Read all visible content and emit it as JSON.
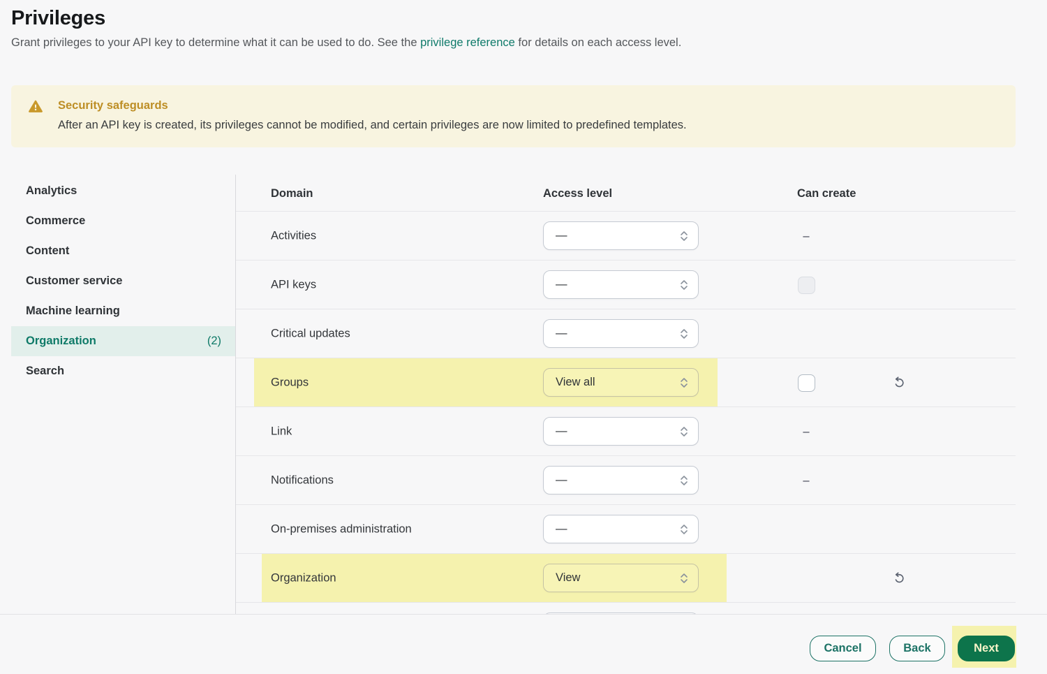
{
  "page": {
    "title": "Privileges",
    "subtitle_before": "Grant privileges to your API key to determine what it can be used to do. See the ",
    "subtitle_link": "privilege reference",
    "subtitle_after": " for details on each access level."
  },
  "warning": {
    "icon": "warning-triangle-icon",
    "title": "Security safeguards",
    "body": "After an API key is created, its privileges cannot be modified, and certain privileges are now limited to predefined templates."
  },
  "sidebar": {
    "items": [
      {
        "label": "Analytics",
        "selected": false,
        "badge": ""
      },
      {
        "label": "Commerce",
        "selected": false,
        "badge": ""
      },
      {
        "label": "Content",
        "selected": false,
        "badge": ""
      },
      {
        "label": "Customer service",
        "selected": false,
        "badge": ""
      },
      {
        "label": "Machine learning",
        "selected": false,
        "badge": ""
      },
      {
        "label": "Organization",
        "selected": true,
        "badge": "(2)"
      },
      {
        "label": "Search",
        "selected": false,
        "badge": ""
      }
    ]
  },
  "table": {
    "columns": {
      "domain": "Domain",
      "access": "Access level",
      "create": "Can create"
    },
    "dash": "–",
    "rows": [
      {
        "domain": "Activities",
        "access_level": "—",
        "can_create": "dash",
        "highlighted": false,
        "undo": false
      },
      {
        "domain": "API keys",
        "access_level": "—",
        "can_create": "checkbox-disabled",
        "highlighted": false,
        "undo": false
      },
      {
        "domain": "Critical updates",
        "access_level": "—",
        "can_create": "none",
        "highlighted": false,
        "undo": false
      },
      {
        "domain": "Groups",
        "access_level": "View all",
        "can_create": "checkbox-unchecked",
        "highlighted": true,
        "undo": true
      },
      {
        "domain": "Link",
        "access_level": "—",
        "can_create": "dash",
        "highlighted": false,
        "undo": false
      },
      {
        "domain": "Notifications",
        "access_level": "—",
        "can_create": "dash",
        "highlighted": false,
        "undo": false
      },
      {
        "domain": "On-premises administration",
        "access_level": "—",
        "can_create": "none",
        "highlighted": false,
        "undo": false
      },
      {
        "domain": "Organization",
        "access_level": "View",
        "can_create": "none",
        "highlighted": true,
        "undo": true
      },
      {
        "domain": "",
        "access_level": "",
        "can_create": "none",
        "highlighted": false,
        "undo": false,
        "clipped": true
      }
    ]
  },
  "footer": {
    "cancel_label": "Cancel",
    "back_label": "Back",
    "next_label": "Next"
  },
  "colors": {
    "accent_teal": "#0f7a6a",
    "button_green": "#0d744b",
    "highlight_yellow": "#f5f2ae",
    "warning_amber": "#bd8e25",
    "warning_bg": "#f8f4e0",
    "selected_item_bg": "#e2efeb"
  }
}
